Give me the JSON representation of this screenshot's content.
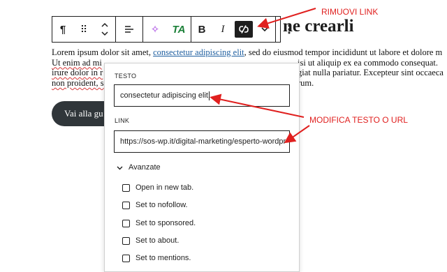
{
  "heading": "ne crearli",
  "paragraph": {
    "line1_pre": "Lorem ipsum dolor sit amet, ",
    "line1_link": "consectetur adipiscing elit",
    "line1_post": ", sed do eiusmod tempor incididunt ut labore et dolore m",
    "line2_left": "Ut enim ad mi",
    "line2_right": "isi ut aliquip ex ea commodo consequat.",
    "line3_left": "irure dolor in r",
    "line3_right": "giat nulla pariatur. Excepteur sint occaeca",
    "line4_left": "non proident, s",
    "line4_right": "rum."
  },
  "page_button": "Vai alla gu",
  "toolbar": {
    "paragraph_icon": "¶",
    "drag_icon": "⠿",
    "align_icon": "≡",
    "ai_icon": "✧",
    "ta_label": "TA",
    "bold_label": "B",
    "italic_label": "I",
    "unlink_icon": "⛓",
    "more_chevron": "⌄",
    "options_icon": "⋮"
  },
  "popover": {
    "text_label": "TESTO",
    "text_value": "consectetur adipiscing elit",
    "link_label": "LINK",
    "link_value": "https://sos-wp.it/digital-marketing/esperto-wordpr",
    "advanced_label": "Avanzate",
    "options": [
      "Open in new tab.",
      "Set to nofollow.",
      "Set to sponsored.",
      "Set to about.",
      "Set to mentions."
    ]
  },
  "annotations": {
    "remove_link": "RIMUOVI LINK",
    "edit_text_url": "MODIFICA TESTO O URL"
  },
  "colors": {
    "annotation": "#e0201f",
    "toolbar_active": "#1e1e1e",
    "link": "#1f5fa0"
  }
}
